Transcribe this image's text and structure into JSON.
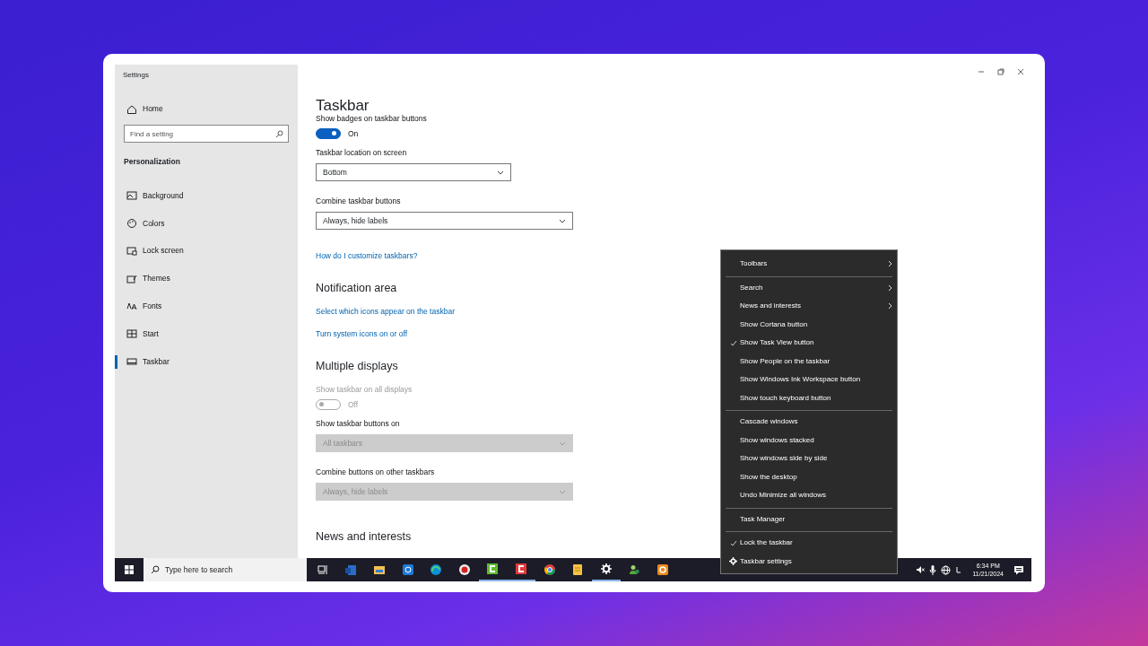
{
  "window": {
    "title": "Settings"
  },
  "sidebar": {
    "home": "Home",
    "search": {
      "placeholder": "Find a setting"
    },
    "section": "Personalization",
    "items": [
      {
        "kind": "background",
        "label": "Background",
        "selected": false
      },
      {
        "kind": "colors",
        "label": "Colors",
        "selected": false
      },
      {
        "kind": "lock",
        "label": "Lock screen",
        "selected": false
      },
      {
        "kind": "themes",
        "label": "Themes",
        "selected": false
      },
      {
        "kind": "fonts",
        "label": "Fonts",
        "selected": false
      },
      {
        "kind": "start",
        "label": "Start",
        "selected": false
      },
      {
        "kind": "taskbar",
        "label": "Taskbar",
        "selected": true
      }
    ]
  },
  "content": {
    "title": "Taskbar",
    "settings": [
      {
        "kind": "toggle",
        "label": "Show badges on taskbar buttons",
        "on": true,
        "state_text": "On",
        "disabled": false
      },
      {
        "kind": "dropdown",
        "label": "Taskbar location on screen",
        "value": "Bottom",
        "disabled": false,
        "wide": false
      },
      {
        "kind": "dropdown",
        "label": "Combine taskbar buttons",
        "value": "Always, hide labels",
        "disabled": false,
        "wide": true
      },
      {
        "kind": "link",
        "label": "How do I customize taskbars?"
      },
      {
        "kind": "heading",
        "label": "Notification area"
      },
      {
        "kind": "link",
        "label": "Select which icons appear on the taskbar"
      },
      {
        "kind": "link",
        "label": "Turn system icons on or off"
      },
      {
        "kind": "heading",
        "label": "Multiple displays"
      },
      {
        "kind": "toggle",
        "label": "Show taskbar on all displays",
        "on": false,
        "state_text": "Off",
        "disabled": true
      },
      {
        "kind": "dropdown",
        "label": "Show taskbar buttons on",
        "value": "All taskbars",
        "disabled": true,
        "wide": true
      },
      {
        "kind": "dropdown",
        "label": "Combine buttons on other taskbars",
        "value": "Always, hide labels",
        "disabled": true,
        "wide": true
      },
      {
        "kind": "heading",
        "label": "News and interests"
      }
    ]
  },
  "context_menu": {
    "items": [
      {
        "kind": "item",
        "label": "Toolbars",
        "checked": false,
        "submenu": true
      },
      {
        "kind": "separator"
      },
      {
        "kind": "item",
        "label": "Search",
        "checked": false,
        "submenu": true
      },
      {
        "kind": "item",
        "label": "News and interests",
        "checked": false,
        "submenu": true
      },
      {
        "kind": "item",
        "label": "Show Cortana button",
        "checked": false,
        "submenu": false
      },
      {
        "kind": "item",
        "label": "Show Task View button",
        "checked": true,
        "submenu": false
      },
      {
        "kind": "item",
        "label": "Show People on the taskbar",
        "checked": false,
        "submenu": false
      },
      {
        "kind": "item",
        "label": "Show Windows Ink Workspace button",
        "checked": false,
        "submenu": false
      },
      {
        "kind": "item",
        "label": "Show touch keyboard button",
        "checked": false,
        "submenu": false
      },
      {
        "kind": "separator"
      },
      {
        "kind": "item",
        "label": "Cascade windows",
        "checked": false,
        "submenu": false
      },
      {
        "kind": "item",
        "label": "Show windows stacked",
        "checked": false,
        "submenu": false
      },
      {
        "kind": "item",
        "label": "Show windows side by side",
        "checked": false,
        "submenu": false
      },
      {
        "kind": "item",
        "label": "Show the desktop",
        "checked": false,
        "submenu": false
      },
      {
        "kind": "item",
        "label": "Undo Minimize all windows",
        "checked": false,
        "submenu": false
      },
      {
        "kind": "separator"
      },
      {
        "kind": "item",
        "label": "Task Manager",
        "checked": false,
        "submenu": false
      },
      {
        "kind": "separator"
      },
      {
        "kind": "item",
        "label": "Lock the taskbar",
        "checked": true,
        "submenu": false
      },
      {
        "kind": "settings",
        "label": "Taskbar settings"
      }
    ]
  },
  "taskbar": {
    "search": {
      "placeholder": "Type here to search"
    },
    "apps": [
      {
        "kind": "taskview",
        "running": false
      },
      {
        "kind": "word",
        "running": false
      },
      {
        "kind": "folder",
        "running": false
      },
      {
        "kind": "bluebox",
        "running": false
      },
      {
        "kind": "browser",
        "running": false
      },
      {
        "kind": "record",
        "running": false
      },
      {
        "kind": "greenc",
        "running": true
      },
      {
        "kind": "redc",
        "running": true
      },
      {
        "kind": "chrome",
        "running": false
      },
      {
        "kind": "note",
        "running": false
      },
      {
        "kind": "gear",
        "running": true
      },
      {
        "kind": "people",
        "running": false
      },
      {
        "kind": "orange",
        "running": false
      }
    ],
    "time": "6:34 PM",
    "date": "11/21/2024"
  }
}
